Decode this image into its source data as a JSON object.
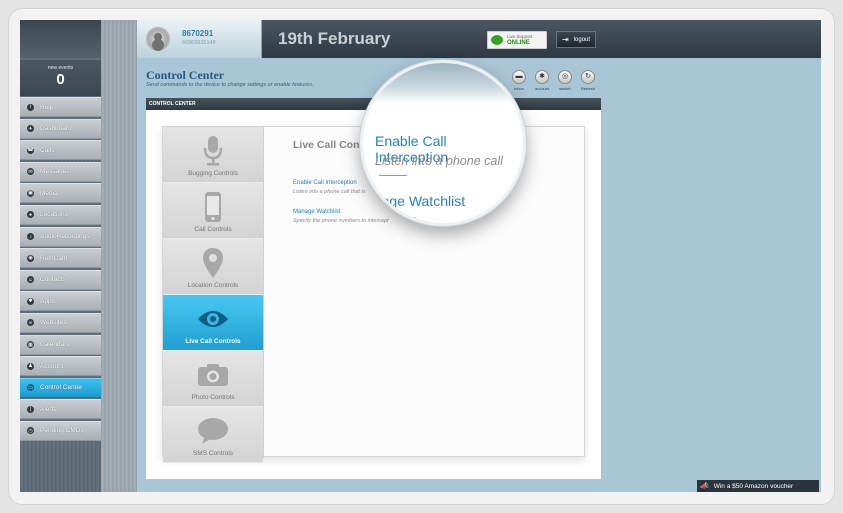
{
  "header": {
    "user_id": "8670291",
    "user_phone": "66869935148",
    "date": "19th February",
    "live_support_label": "Live Support",
    "live_support_status": "ONLINE",
    "logout_label": "logout"
  },
  "sidebar": {
    "new_events_label": "new events",
    "new_events_count": "0",
    "items": [
      {
        "label": "Help",
        "icon": "i"
      },
      {
        "label": "Dashboard",
        "icon": "✈"
      },
      {
        "label": "Calls",
        "icon": "☎"
      },
      {
        "label": "Messages",
        "icon": "✉"
      },
      {
        "label": "Media",
        "icon": "▣"
      },
      {
        "label": "Locations",
        "icon": "●"
      },
      {
        "label": "AudioRecordings",
        "icon": "♪"
      },
      {
        "label": "RemCam",
        "icon": "◉"
      },
      {
        "label": "Contacts",
        "icon": "☺"
      },
      {
        "label": "Apps",
        "icon": "✱"
      },
      {
        "label": "Websites",
        "icon": "∞"
      },
      {
        "label": "Calendars",
        "icon": "▦"
      },
      {
        "label": "Account",
        "icon": "♟"
      },
      {
        "label": "Control Center",
        "icon": "▭"
      },
      {
        "label": "Alerts",
        "icon": "❘"
      },
      {
        "label": "Pending CMDs",
        "icon": "◷"
      }
    ],
    "active_item": "Control Center"
  },
  "control_center": {
    "title": "Control Center",
    "subtitle": "Send commands to the device to change settings or enable features.",
    "panel_bar": "CONTROL CENTER",
    "toolbar": [
      {
        "label": "inbox",
        "icon": "inbox-icon",
        "glyph": "▬"
      },
      {
        "label": "account",
        "icon": "gear-icon",
        "glyph": "✱"
      },
      {
        "label": "sketch",
        "icon": "sketch-icon",
        "glyph": "◎"
      },
      {
        "label": "Refresh",
        "icon": "refresh-icon",
        "glyph": "↻"
      }
    ],
    "tabs": [
      {
        "label": "Bugging Controls",
        "icon": "microphone-icon"
      },
      {
        "label": "Call Controls",
        "icon": "phone-icon"
      },
      {
        "label": "Location Controls",
        "icon": "location-pin-icon"
      },
      {
        "label": "Live Call Controls",
        "icon": "eye-icon"
      },
      {
        "label": "Photo Controls",
        "icon": "camera-icon"
      },
      {
        "label": "SMS Controls",
        "icon": "speech-bubble-icon"
      }
    ],
    "active_tab": "Live Call Controls",
    "content_title": "Live Call Contr",
    "links": [
      {
        "label": "Enable Call Interception",
        "desc": "Listen into a phone call that is"
      },
      {
        "label": "Manage Watchlist",
        "desc": "Specify the phone numbers to intercept"
      }
    ]
  },
  "magnifier": {
    "link1": "Enable Call Interception",
    "desc1": "Listen into a phone call",
    "link2": "anage Watchlist",
    "desc2": "the pho"
  },
  "promo": {
    "label": "Win a $50 Amazon voucher"
  },
  "colors": {
    "accent": "#1f9fd3",
    "link": "#2183c6",
    "online": "#33a326",
    "screen_bg": "#a9c6d6"
  }
}
